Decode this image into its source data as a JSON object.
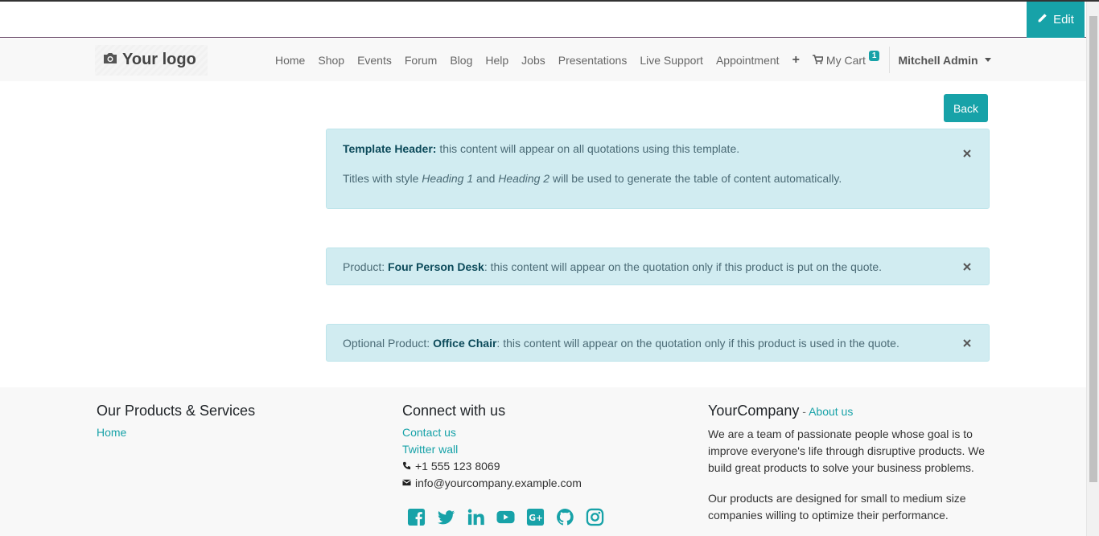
{
  "editbar": {
    "edit_label": "Edit"
  },
  "navbar": {
    "logo_text": "Your logo",
    "links": [
      "Home",
      "Shop",
      "Events",
      "Forum",
      "Blog",
      "Help",
      "Jobs",
      "Presentations",
      "Live Support",
      "Appointment"
    ],
    "cart_label": "My Cart",
    "cart_count": "1",
    "user_name": "Mitchell Admin"
  },
  "main": {
    "back_label": "Back",
    "template_header": {
      "title": "Template Header:",
      "text": " this content will appear on all quotations using this template.",
      "hint_pre": "Titles with style ",
      "hint_h1": "Heading 1",
      "hint_mid": " and ",
      "hint_h2": "Heading 2",
      "hint_post": " will be used to generate the table of content automatically."
    },
    "product": {
      "prefix": "Product: ",
      "name": "Four Person Desk",
      "text": ": this content will appear on the quotation only if this product is put on the quote."
    },
    "optional_product": {
      "prefix": "Optional Product: ",
      "name": "Office Chair",
      "text": ": this content will appear on the quotation only if this product is used in the quote."
    }
  },
  "footer": {
    "products_title": "Our Products & Services",
    "products_links": [
      "Home"
    ],
    "connect_title": "Connect with us",
    "contact_label": "Contact us",
    "twitter_label": "Twitter wall",
    "phone": "+1 555 123 8069",
    "email": "info@yourcompany.example.com",
    "social_icons": [
      "facebook-icon",
      "twitter-icon",
      "linkedin-icon",
      "youtube-icon",
      "google-plus-icon",
      "github-icon",
      "instagram-icon"
    ],
    "company_name": "YourCompany",
    "about_sep": " - ",
    "about_link": "About us",
    "about_p1": "We are a team of passionate people whose goal is to improve everyone's life through disruptive products. We build great products to solve your business problems.",
    "about_p2": "Our products are designed for small to medium size companies willing to optimize their performance.",
    "accent_color": "#17a2a8"
  }
}
